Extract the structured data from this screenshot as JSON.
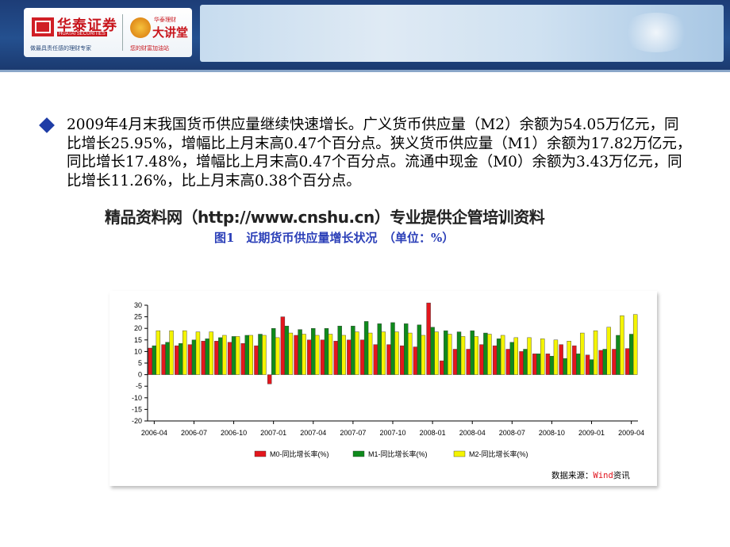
{
  "header": {
    "brand_name": "华泰证券",
    "brand_en": "HUATAI SECURITIES",
    "brand_slogan": "做最具责任感的理财专家",
    "lecture_top": "华泰理财",
    "lecture_name": "大讲堂",
    "lecture_slogan": "您的财富加油站"
  },
  "body": {
    "paragraph": "2009年4月末我国货币供应量继续快速增长。广义货币供应量（M2）余额为54.05万亿元，同比增长25.95%，增幅比上月末高0.47个百分点。狭义货币供应量（M1）余额为17.82万亿元，同比增长17.48%，增幅比上月末高0.47个百分点。流通中现金（M0）余额为3.43万亿元，同比增长11.26%，比上月末高0.38个百分点。",
    "watermark": "精品资料网（http://www.cnshu.cn）专业提供企管培训资料",
    "chart_title": "图1　近期货币供应量增长状况　（单位：%）",
    "source_label": "数据来源：",
    "source_wind": "Wind",
    "source_suffix": "资讯"
  },
  "colors": {
    "m0": "#e3161d",
    "m1": "#0f8a1c",
    "m2": "#f4f400",
    "header_bg": "#1d3d77",
    "title_blue": "#2b3fb8"
  },
  "chart_data": {
    "type": "bar",
    "categories": [
      "2006-04",
      "2006-05",
      "2006-06",
      "2006-07",
      "2006-08",
      "2006-09",
      "2006-10",
      "2006-11",
      "2006-12",
      "2007-01",
      "2007-02",
      "2007-03",
      "2007-04",
      "2007-05",
      "2007-06",
      "2007-07",
      "2007-08",
      "2007-09",
      "2007-10",
      "2007-11",
      "2007-12",
      "2008-01",
      "2008-02",
      "2008-03",
      "2008-04",
      "2008-05",
      "2008-06",
      "2008-07",
      "2008-08",
      "2008-09",
      "2008-10",
      "2008-11",
      "2008-12",
      "2009-01",
      "2009-02",
      "2009-03",
      "2009-04"
    ],
    "x_tick_labels": [
      "2006-04",
      "2006-07",
      "2006-10",
      "2007-01",
      "2007-04",
      "2007-07",
      "2007-10",
      "2008-01",
      "2008-04",
      "2008-07",
      "2008-10",
      "2009-01",
      "2009-04"
    ],
    "series": [
      {
        "name": "M0-同比增长率(%)",
        "values": [
          11.5,
          13,
          12.5,
          13,
          14.5,
          14.5,
          14,
          13.5,
          12.5,
          -4,
          25,
          17,
          15,
          15,
          14.5,
          15,
          15,
          13,
          13,
          12.5,
          12,
          31,
          6,
          11,
          11,
          13,
          12.5,
          11,
          10,
          9,
          9,
          13,
          12.5,
          8.5,
          10.5,
          11,
          11.3
        ]
      },
      {
        "name": "M1-同比增长率(%)",
        "values": [
          12.5,
          14,
          13.5,
          15,
          15.5,
          16,
          16.5,
          17,
          17.5,
          20,
          21,
          19.5,
          20,
          20,
          21,
          21,
          23,
          22,
          22.5,
          22,
          21.5,
          20.5,
          19,
          18.5,
          19,
          18,
          15.5,
          14,
          11,
          9,
          8,
          7,
          9,
          6.5,
          11,
          17,
          17.5
        ]
      },
      {
        "name": "M2-同比增长率(%)",
        "values": [
          19,
          19,
          19,
          18.5,
          18.5,
          17,
          16.5,
          17,
          17,
          16,
          18,
          17.5,
          17,
          17.5,
          17,
          18.5,
          18,
          18.5,
          18.5,
          18,
          17,
          18.5,
          17.5,
          16.5,
          16.5,
          17.5,
          17,
          16,
          16,
          15.5,
          15,
          14.5,
          18,
          19,
          20.5,
          25.5,
          26
        ]
      }
    ],
    "ylim": [
      -20,
      30
    ],
    "yticks": [
      -20,
      -15,
      -10,
      -5,
      0,
      5,
      10,
      15,
      20,
      25,
      30
    ],
    "legend_position": "bottom",
    "grid": false
  }
}
